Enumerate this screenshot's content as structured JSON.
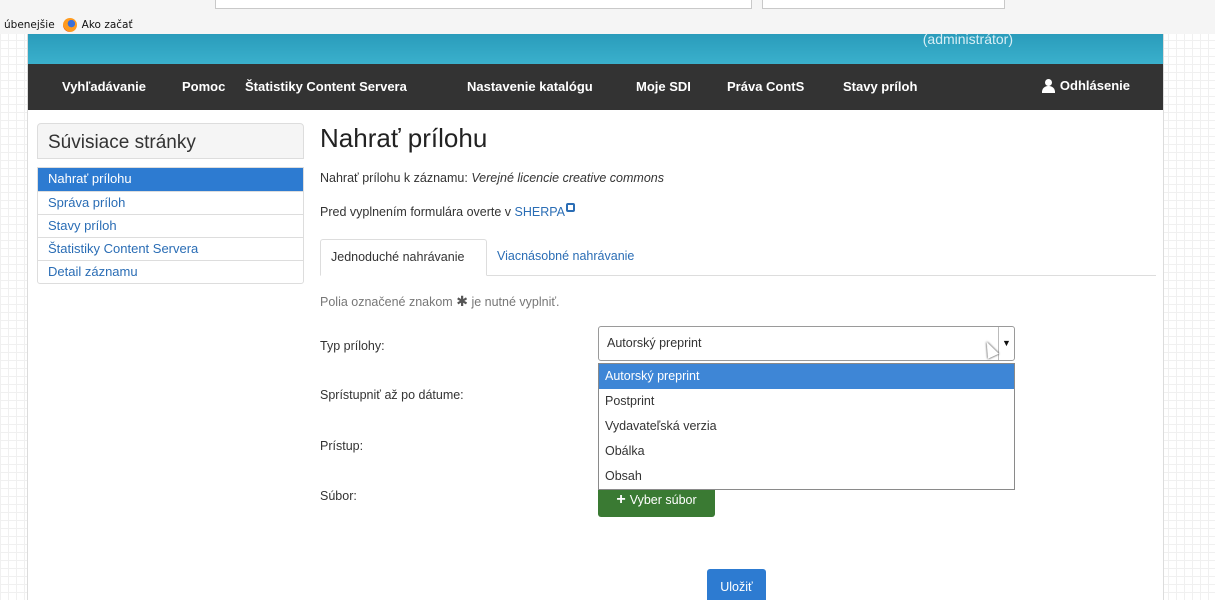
{
  "browser": {
    "bookmarks": [
      "úbenejšie",
      "Ako začať"
    ]
  },
  "header": {
    "admin_text": "(administrátor)"
  },
  "navbar": {
    "items": [
      {
        "label": "Vyhľadávanie"
      },
      {
        "label": "Pomoc"
      },
      {
        "label": "Štatistiky Content Servera"
      },
      {
        "label": "Nastavenie katalógu"
      },
      {
        "label": "Moje SDI"
      },
      {
        "label": "Práva ContS"
      },
      {
        "label": "Stavy príloh"
      }
    ],
    "logout_label": "Odhlásenie"
  },
  "sidebar": {
    "title": "Súvisiace stránky",
    "items": [
      {
        "label": "Nahrať prílohu",
        "active": true
      },
      {
        "label": "Správa príloh"
      },
      {
        "label": "Stavy príloh"
      },
      {
        "label": "Štatistiky Content Servera"
      },
      {
        "label": "Detail záznamu"
      }
    ]
  },
  "main": {
    "title": "Nahrať prílohu",
    "record_prefix": "Nahrať prílohu k záznamu:",
    "record_name": "Verejné licencie creative commons",
    "sherpa_prefix": "Pred vyplnením formulára overte v",
    "sherpa_link": "SHERPA",
    "tabs": [
      {
        "label": "Jednoduché nahrávanie",
        "active": true
      },
      {
        "label": "Viacnásobné nahrávanie"
      }
    ],
    "required_note_prefix": "Polia označené znakom",
    "required_note_suffix": "je nutné vyplniť.",
    "form": {
      "type_label": "Typ prílohy:",
      "type_value": "Autorský preprint",
      "type_options": [
        "Autorský preprint",
        "Postprint",
        "Vydavateľská verzia",
        "Obálka",
        "Obsah"
      ],
      "date_label": "Sprístupniť až po dátume:",
      "access_label": "Prístup:",
      "file_label": "Súbor:",
      "file_button": "Vyber súbor"
    },
    "save_label": "Uložiť"
  },
  "colors": {
    "navbar_bg": "#333333",
    "banner": "#2a9cbb",
    "active_item": "#2d7bd1",
    "link": "#2a6db5",
    "file_button": "#3a7a33"
  }
}
